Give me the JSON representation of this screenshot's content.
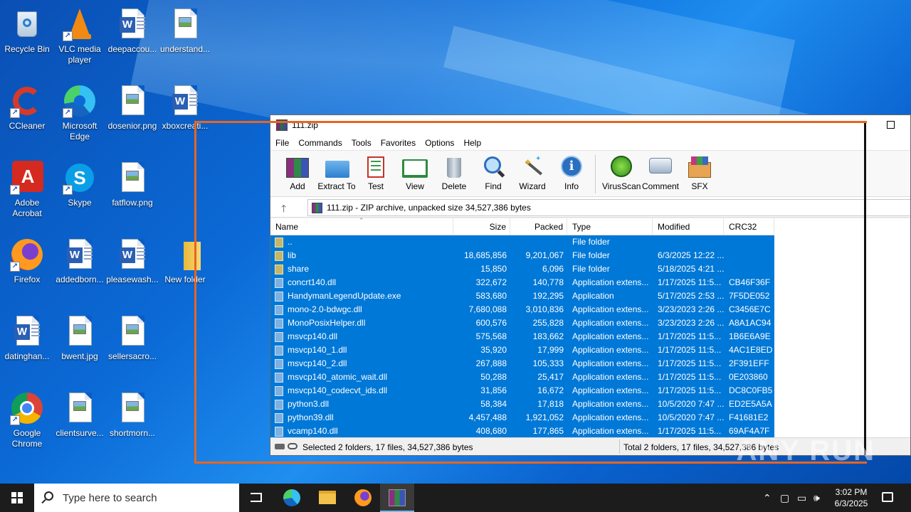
{
  "desktop": {
    "icons": [
      {
        "label": "Recycle Bin",
        "icon": "recycle-bin-icon"
      },
      {
        "label": "VLC media player",
        "icon": "vlc-icon"
      },
      {
        "label": "deepaccou...",
        "icon": "word-document-icon"
      },
      {
        "label": "understand...",
        "icon": "image-file-icon"
      },
      {
        "label": "CCleaner",
        "icon": "ccleaner-icon"
      },
      {
        "label": "Microsoft Edge",
        "icon": "edge-icon"
      },
      {
        "label": "dosenior.png",
        "icon": "image-file-icon"
      },
      {
        "label": "xboxcreati...",
        "icon": "word-document-icon"
      },
      {
        "label": "Adobe Acrobat",
        "icon": "acrobat-icon"
      },
      {
        "label": "Skype",
        "icon": "skype-icon"
      },
      {
        "label": "fatflow.png",
        "icon": "image-file-icon"
      },
      {
        "label": "Firefox",
        "icon": "firefox-icon"
      },
      {
        "label": "addedborn...",
        "icon": "word-document-icon"
      },
      {
        "label": "pleasewash...",
        "icon": "word-document-icon"
      },
      {
        "label": "New folder",
        "icon": "folder-icon"
      },
      {
        "label": "datinghan...",
        "icon": "word-document-icon"
      },
      {
        "label": "bwent.jpg",
        "icon": "image-file-icon"
      },
      {
        "label": "sellersacro...",
        "icon": "image-file-icon"
      },
      {
        "label": "Google Chrome",
        "icon": "chrome-icon"
      },
      {
        "label": "clientsurve...",
        "icon": "image-file-icon"
      },
      {
        "label": "shortmorn...",
        "icon": "image-file-icon"
      }
    ]
  },
  "window": {
    "title": "111.zip",
    "menu": [
      "File",
      "Commands",
      "Tools",
      "Favorites",
      "Options",
      "Help"
    ],
    "toolbar": [
      "Add",
      "Extract To",
      "Test",
      "View",
      "Delete",
      "Find",
      "Wizard",
      "Info",
      "VirusScan",
      "Comment",
      "SFX"
    ],
    "address": "111.zip - ZIP archive, unpacked size 34,527,386 bytes",
    "columns": {
      "name": "Name",
      "size": "Size",
      "packed": "Packed",
      "type": "Type",
      "modified": "Modified",
      "crc": "CRC32"
    },
    "files": [
      {
        "name": "..",
        "size": "",
        "packed": "",
        "type": "File folder",
        "modified": "",
        "crc": "",
        "kind": "folder"
      },
      {
        "name": "lib",
        "size": "18,685,856",
        "packed": "9,201,067",
        "type": "File folder",
        "modified": "6/3/2025 12:22 ...",
        "crc": "",
        "kind": "folder"
      },
      {
        "name": "share",
        "size": "15,850",
        "packed": "6,096",
        "type": "File folder",
        "modified": "5/18/2025 4:21 ...",
        "crc": "",
        "kind": "folder"
      },
      {
        "name": "concrt140.dll",
        "size": "322,672",
        "packed": "140,778",
        "type": "Application extens...",
        "modified": "1/17/2025 11:5...",
        "crc": "CB46F36F",
        "kind": "file"
      },
      {
        "name": "HandymanLegendUpdate.exe",
        "size": "583,680",
        "packed": "192,295",
        "type": "Application",
        "modified": "5/17/2025 2:53 ...",
        "crc": "7F5DE052",
        "kind": "file"
      },
      {
        "name": "mono-2.0-bdwgc.dll",
        "size": "7,680,088",
        "packed": "3,010,836",
        "type": "Application extens...",
        "modified": "3/23/2023 2:26 ...",
        "crc": "C3456E7C",
        "kind": "file"
      },
      {
        "name": "MonoPosixHelper.dll",
        "size": "600,576",
        "packed": "255,828",
        "type": "Application extens...",
        "modified": "3/23/2023 2:26 ...",
        "crc": "A8A1AC94",
        "kind": "file"
      },
      {
        "name": "msvcp140.dll",
        "size": "575,568",
        "packed": "183,662",
        "type": "Application extens...",
        "modified": "1/17/2025 11:5...",
        "crc": "1B6E6A9E",
        "kind": "file"
      },
      {
        "name": "msvcp140_1.dll",
        "size": "35,920",
        "packed": "17,999",
        "type": "Application extens...",
        "modified": "1/17/2025 11:5...",
        "crc": "4AC1E8ED",
        "kind": "file"
      },
      {
        "name": "msvcp140_2.dll",
        "size": "267,888",
        "packed": "105,333",
        "type": "Application extens...",
        "modified": "1/17/2025 11:5...",
        "crc": "2F391EFF",
        "kind": "file"
      },
      {
        "name": "msvcp140_atomic_wait.dll",
        "size": "50,288",
        "packed": "25,417",
        "type": "Application extens...",
        "modified": "1/17/2025 11:5...",
        "crc": "0E203860",
        "kind": "file"
      },
      {
        "name": "msvcp140_codecvt_ids.dll",
        "size": "31,856",
        "packed": "16,672",
        "type": "Application extens...",
        "modified": "1/17/2025 11:5...",
        "crc": "DC8C0FB5",
        "kind": "file"
      },
      {
        "name": "python3.dll",
        "size": "58,384",
        "packed": "17,818",
        "type": "Application extens...",
        "modified": "10/5/2020 7:47 ...",
        "crc": "ED2E5A5A",
        "kind": "file"
      },
      {
        "name": "python39.dll",
        "size": "4,457,488",
        "packed": "1,921,052",
        "type": "Application extens...",
        "modified": "10/5/2020 7:47 ...",
        "crc": "F41681E2",
        "kind": "file"
      },
      {
        "name": "vcamp140.dll",
        "size": "408,680",
        "packed": "177,865",
        "type": "Application extens...",
        "modified": "1/17/2025 11:5...",
        "crc": "69AF4A7F",
        "kind": "file"
      }
    ],
    "status_left": "Selected 2 folders, 17 files, 34,527,386 bytes",
    "status_right": "Total 2 folders, 17 files, 34,527,386 bytes"
  },
  "taskbar": {
    "search_placeholder": "Type here to search",
    "time": "3:02 PM",
    "date": "6/3/2025"
  },
  "watermark": "ANY RUN"
}
